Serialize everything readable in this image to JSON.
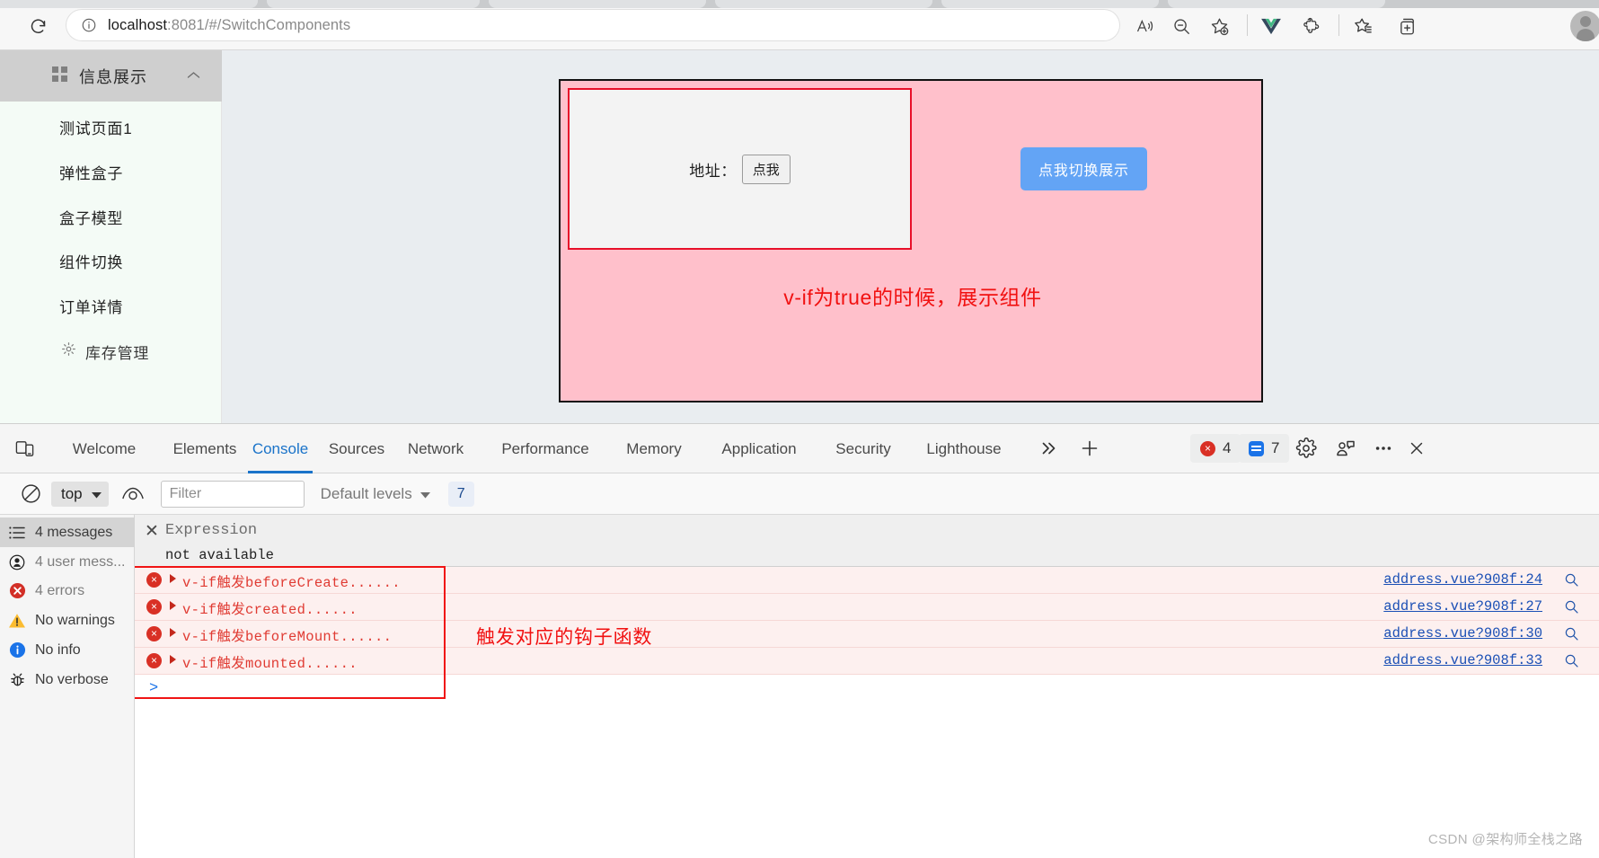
{
  "browser": {
    "url_host": "localhost",
    "url_rest": ":8081/#/SwitchComponents",
    "reload_icon": "reload-icon",
    "info_icon": "site-info-icon",
    "toolbar_icons": [
      {
        "name": "read-aloud-icon"
      },
      {
        "name": "zoom-out-icon"
      },
      {
        "name": "add-favorite-icon"
      },
      {
        "name": "vue-devtools-icon"
      },
      {
        "name": "extensions-icon"
      },
      {
        "name": "favorites-icon"
      },
      {
        "name": "collections-icon"
      },
      {
        "name": "profile-avatar"
      }
    ]
  },
  "sidebar": {
    "header": {
      "label": "信息展示",
      "icon": "grid-icon",
      "chevron": "chevron-up-icon"
    },
    "items": [
      {
        "label": "测试页面1"
      },
      {
        "label": "弹性盒子"
      },
      {
        "label": "盒子模型"
      },
      {
        "label": "组件切换"
      },
      {
        "label": "订单详情"
      },
      {
        "label": "库存管理",
        "icon": "gear-icon"
      }
    ]
  },
  "demo": {
    "address_label": "地址：",
    "address_button": "点我",
    "switch_button": "点我切换展示",
    "note": "v-if为true的时候，展示组件",
    "note_color": "#f11111",
    "panel_bg": "#ffc0cb",
    "inner_border": "#e8102a"
  },
  "devtools": {
    "device_icon": "device-toolbar-icon",
    "tabs": [
      {
        "label": "Welcome",
        "active": false
      },
      {
        "label": "Elements",
        "active": false
      },
      {
        "label": "Console",
        "active": true
      },
      {
        "label": "Sources",
        "active": false
      },
      {
        "label": "Network",
        "active": false
      },
      {
        "label": "Performance",
        "active": false
      },
      {
        "label": "Memory",
        "active": false
      },
      {
        "label": "Application",
        "active": false
      },
      {
        "label": "Security",
        "active": false
      },
      {
        "label": "Lighthouse",
        "active": false
      }
    ],
    "more_tabs_icon": "chevron-double-right-icon",
    "add_tab_icon": "plus-icon",
    "error_count": "4",
    "message_count": "7",
    "settings_icon": "gear-icon",
    "feedback_icon": "feedback-icon",
    "more_icon": "more-options-icon",
    "close_icon": "close-icon",
    "filterbar": {
      "clear_icon": "clear-console-icon",
      "context": "top",
      "eye_icon": "create-live-expression-icon",
      "filter_placeholder": "Filter",
      "filter_value": "",
      "levels": "Default levels",
      "message_badge": "7"
    },
    "console_sidebar": [
      {
        "label": "4 messages",
        "icon": "list-icon",
        "selected": true
      },
      {
        "label": "4 user mess...",
        "icon": "user-message-icon",
        "selected": false
      },
      {
        "label": "4 errors",
        "icon": "error-icon",
        "selected": false
      },
      {
        "label": "No warnings",
        "icon": "warning-icon",
        "selected": false
      },
      {
        "label": "No info",
        "icon": "info-icon",
        "selected": false
      },
      {
        "label": "No verbose",
        "icon": "verbose-bug-icon",
        "selected": false
      }
    ],
    "live_expression": {
      "title": "Expression",
      "value": "not available"
    },
    "logs": [
      {
        "level": "error",
        "message": "v-if触发beforeCreate......",
        "source": "address.vue?908f:24"
      },
      {
        "level": "error",
        "message": "v-if触发created......",
        "source": "address.vue?908f:27"
      },
      {
        "level": "error",
        "message": "v-if触发beforeMount......",
        "source": "address.vue?908f:30"
      },
      {
        "level": "error",
        "message": "v-if触发mounted......",
        "source": "address.vue?908f:33"
      }
    ],
    "prompt_symbol": ">",
    "console_annotation": "触发对应的钩子函数"
  },
  "watermark": "CSDN @架构师全栈之路"
}
